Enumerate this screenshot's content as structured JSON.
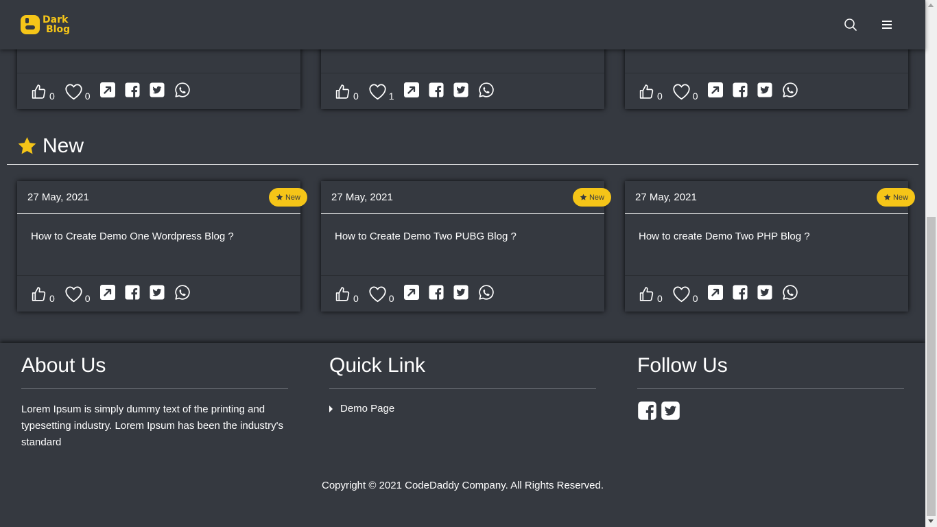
{
  "header": {
    "logo_line1": "Dark",
    "logo_line2": "Blog",
    "search_icon": "search-icon",
    "menu_icon": "hamburger-menu-icon"
  },
  "top_cards": [
    {
      "likes": "0",
      "hearts": "0"
    },
    {
      "likes": "0",
      "hearts": "1"
    },
    {
      "likes": "0",
      "hearts": "0"
    }
  ],
  "new_section": {
    "title": "New",
    "icon": "star-icon"
  },
  "new_cards": [
    {
      "date": "27 May, 2021",
      "badge": "New",
      "title": "How to Create Demo One Wordpress Blog ?",
      "likes": "0",
      "hearts": "0"
    },
    {
      "date": "27 May, 2021",
      "badge": "New",
      "title": "How to Create Demo Two PUBG Blog ?",
      "likes": "0",
      "hearts": "0"
    },
    {
      "date": "27 May, 2021",
      "badge": "New",
      "title": "How to create Demo Two PHP Blog ?",
      "likes": "0",
      "hearts": "0"
    }
  ],
  "footer": {
    "about_title": "About Us",
    "about_text": "Lorem Ipsum is simply dummy text of the printing and typesetting industry. Lorem Ipsum has been the industry's standard",
    "quick_title": "Quick Link",
    "quick_links": [
      "Demo Page"
    ],
    "follow_title": "Follow Us",
    "copyright": "Copyright © 2021  CodeDaddy Company. All Rights Reserved."
  },
  "colors": {
    "background": "#353940",
    "accent": "#f5c518",
    "text": "#ffffff"
  }
}
